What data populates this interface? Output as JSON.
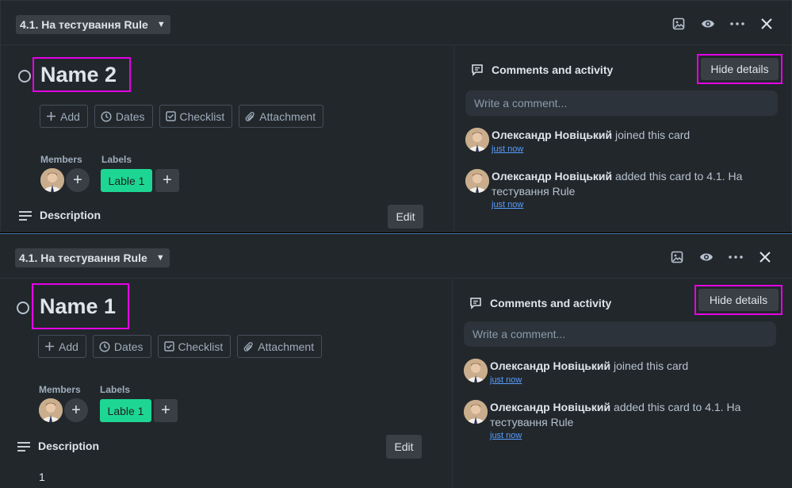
{
  "cards": [
    {
      "list_name": "4.1. На тестування Rule",
      "title": "Name 2",
      "actions": {
        "add": "Add",
        "dates": "Dates",
        "checklist": "Checklist",
        "attachment": "Attachment"
      },
      "members_label": "Members",
      "labels_label": "Labels",
      "label_chip": "Lable 1",
      "label_color": "#1ed693",
      "description_label": "Description",
      "edit_label": "Edit",
      "description_text": "",
      "side": {
        "title": "Comments and activity",
        "hide_details": "Hide details",
        "comment_placeholder": "Write a comment...",
        "activity": [
          {
            "user": "Олександр Новіцький",
            "text": " joined this card",
            "time": "just now"
          },
          {
            "user": "Олександр Новіцький",
            "text": " added this card to 4.1. На тестування Rule",
            "time": "just now"
          }
        ]
      }
    },
    {
      "list_name": "4.1. На тестування Rule",
      "title": "Name 1",
      "actions": {
        "add": "Add",
        "dates": "Dates",
        "checklist": "Checklist",
        "attachment": "Attachment"
      },
      "members_label": "Members",
      "labels_label": "Labels",
      "label_chip": "Lable 1",
      "label_color": "#1ed693",
      "description_label": "Description",
      "edit_label": "Edit",
      "description_text": "1",
      "side": {
        "title": "Comments and activity",
        "hide_details": "Hide details",
        "comment_placeholder": "Write a comment...",
        "activity": [
          {
            "user": "Олександр Новіцький",
            "text": " joined this card",
            "time": "just now"
          },
          {
            "user": "Олександр Новіцький",
            "text": " added this card to 4.1. На тестування Rule",
            "time": "just now"
          }
        ]
      }
    }
  ],
  "highlight_color": "#e600e6"
}
